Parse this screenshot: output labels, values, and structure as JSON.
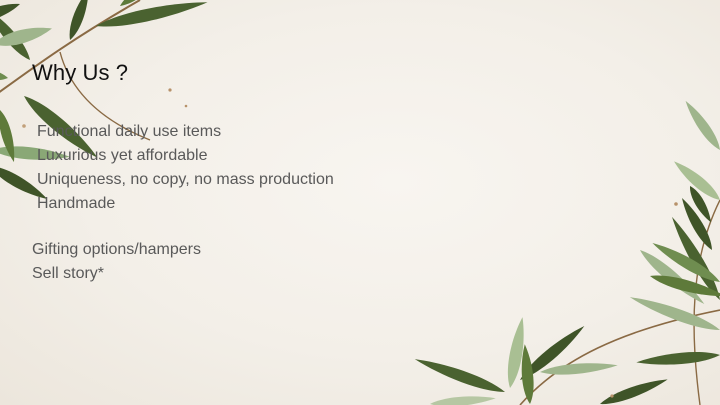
{
  "slide": {
    "title": "Why Us ?",
    "features": [
      "Functional daily use items",
      "Luxurious yet affordable",
      "Uniqueness, no copy, no mass production",
      "Handmade"
    ],
    "extras": [
      "Gifting options/hampers",
      "Sell story*"
    ]
  },
  "colors": {
    "background": "#f4f0ea",
    "leaf_dark": "#3f5428",
    "leaf_mid": "#5e7a3a",
    "leaf_light": "#9fb58c",
    "branch": "#8a6a44",
    "title_text": "#111111",
    "body_text": "#595959"
  },
  "decorations": [
    "olive-branch-top-left",
    "olive-branch-bottom-right"
  ]
}
